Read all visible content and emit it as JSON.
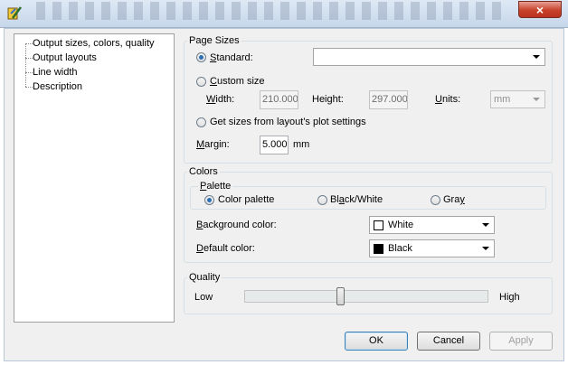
{
  "window": {
    "icon": "app-icon",
    "close_icon": "×"
  },
  "tree": {
    "items": [
      "Output sizes, colors, quality",
      "Output layouts",
      "Line width",
      "Description"
    ]
  },
  "page_sizes": {
    "legend": "Page Sizes",
    "standard_label": "Standard:",
    "standard_value": "",
    "custom_label": "Custom size",
    "width_label": "Width:",
    "width_value": "210.000",
    "height_label": "Height:",
    "height_value": "297.000",
    "units_label": "Units:",
    "units_value": "mm",
    "plot_settings_label": "Get sizes from layout's plot settings",
    "margin_label": "Margin:",
    "margin_value": "5.000",
    "margin_unit": "mm",
    "selected": "standard"
  },
  "colors": {
    "legend": "Colors",
    "palette_legend": "Palette",
    "palette_options": [
      "Color palette",
      "Black/White",
      "Gray"
    ],
    "palette_selected": "Color palette",
    "background_label": "Background color:",
    "background_value": "White",
    "background_swatch": "#ffffff",
    "default_label": "Default color:",
    "default_value": "Black",
    "default_swatch": "#000000"
  },
  "quality": {
    "legend": "Quality",
    "low_label": "Low",
    "high_label": "High",
    "level": 0.39
  },
  "buttons": {
    "ok": "OK",
    "cancel": "Cancel",
    "apply": "Apply"
  }
}
